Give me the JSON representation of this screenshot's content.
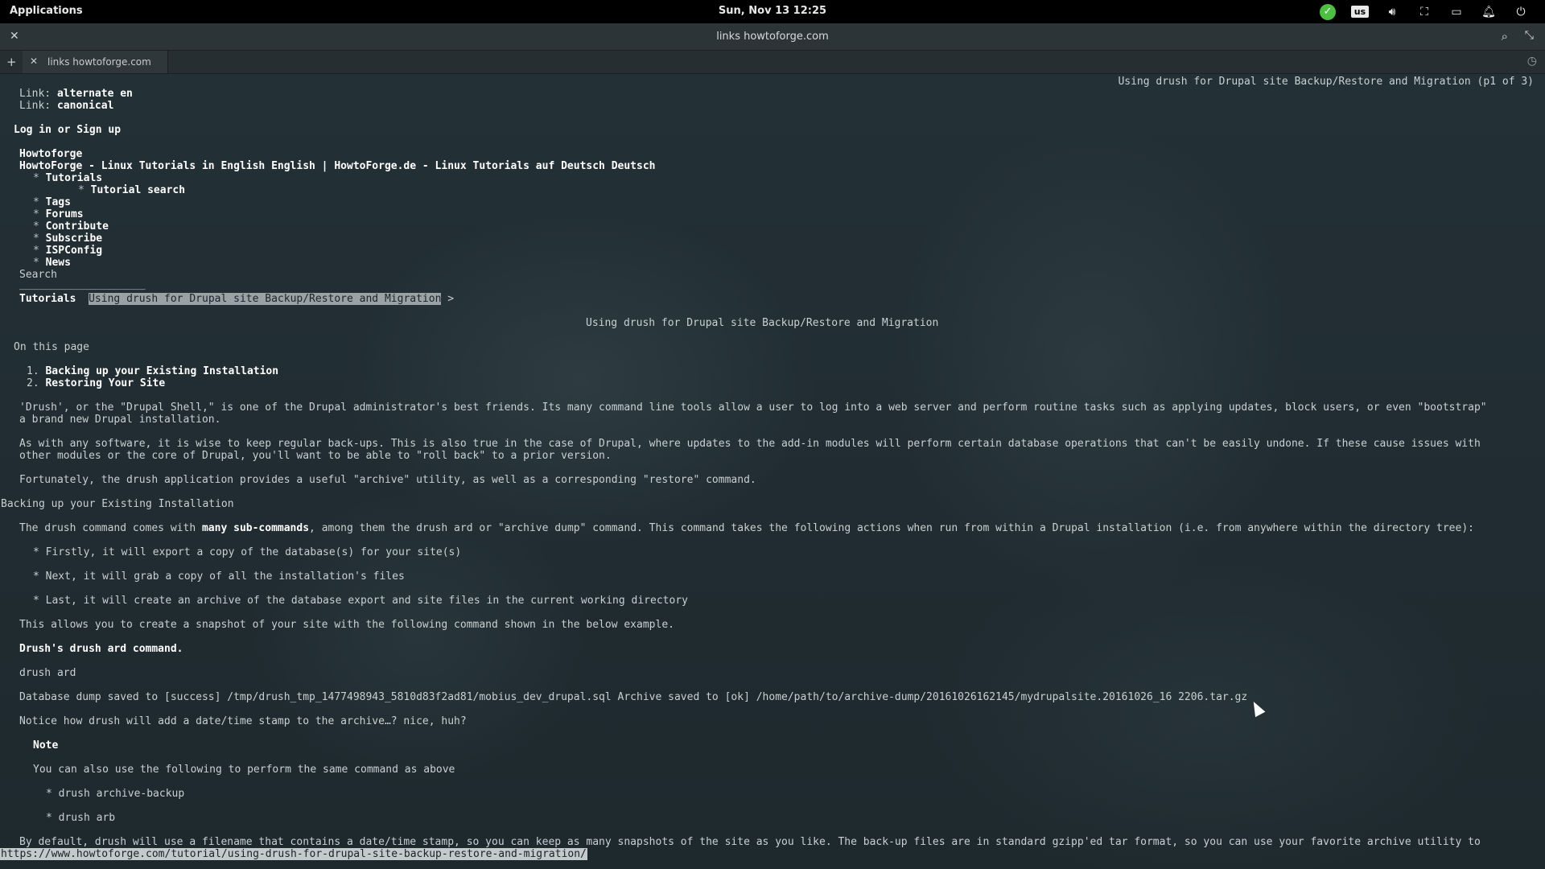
{
  "panel": {
    "apps_label": "Applications",
    "datetime": "Sun, Nov 13   12:25",
    "keyboard_layout": "us",
    "colors": {
      "status_ok": "#4fbf43"
    }
  },
  "window": {
    "title": "links howtoforge.com",
    "tab_label": "links howtoforge.com"
  },
  "page": {
    "position": "Using drush for Drupal site Backup/Restore and Migration (p1 of 3)",
    "link1_prefix": "Link: ",
    "link1": "alternate en",
    "link2_prefix": "Link: ",
    "link2": "canonical",
    "login": "Log in or Sign up",
    "site": "Howtoforge",
    "lang_line": "HowtoForge - Linux Tutorials in English English | HowtoForge.de - Linux Tutorials auf Deutsch Deutsch",
    "nav": {
      "tutorials": "Tutorials",
      "tutorial_search": "Tutorial search",
      "tags": "Tags",
      "forums": "Forums",
      "contribute": "Contribute",
      "subscribe": "Subscribe",
      "ispconfig": "ISPConfig",
      "news": "News"
    },
    "search_label": "Search",
    "search_field": "____________________",
    "breadcrumb_root": "Tutorials",
    "breadcrumb_current": "Using drush for Drupal site Backup/Restore and Migration",
    "breadcrumb_sep": ">",
    "heading": "Using drush for Drupal site Backup/Restore and Migration",
    "toc_label": "On this page",
    "toc1_num": "1.",
    "toc1": "Backing up your Existing Installation",
    "toc2_num": "2.",
    "toc2": "Restoring Your Site",
    "p1a": "'Drush', or the \"Drupal Shell,\" is one of the Drupal administrator's best friends. Its many command line tools allow a user to log into a web server and perform routine tasks such as applying updates, block users, or even \"bootstrap\"",
    "p1b": "a brand new Drupal installation.",
    "p2a": "As with any software, it is wise to keep regular back-ups. This is also true in the case of Drupal, where updates to the add-in modules will perform certain database operations that can't be easily undone. If these cause issues with",
    "p2b": "other modules or the core of Drupal, you'll want to be able to \"roll back\" to a prior version.",
    "p3": "Fortunately, the drush application provides a useful \"archive\" utility, as well as a corresponding \"restore\" command.",
    "section1": "Backing up your Existing Installation",
    "p4_pre": "The drush command comes with ",
    "p4_link": "many sub-commands",
    "p4_post": ", among them the drush ard or \"archive dump\" command. This command takes the following actions when run from within a Drupal installation (i.e. from anywhere within the directory tree):",
    "bullet1": "* Firstly, it will export a copy of the database(s) for your site(s)",
    "bullet2": "* Next, it will grab a copy of all the installation's files",
    "bullet3": "* Last, it will create an archive of the database export and site files in the current working directory",
    "p5": "This allows you to create a snapshot of your site with the following command shown in the below example.",
    "caption": "Drush's drush ard command.",
    "cmd": "drush ard",
    "output": "Database dump saved to [success] /tmp/drush_tmp_1477498943_5810d83f2ad81/mobius_dev_drupal.sql Archive saved to [ok] /home/path/to/archive-dump/20161026162145/mydrupalsite.20161026_16 2206.tar.gz",
    "p6": "Notice how drush will add a date/time stamp to the archive…? nice, huh?",
    "note_title": "Note",
    "note_text": "You can also use the following to perform the same command as above",
    "alt1": "* drush archive-backup",
    "alt2": "* drush arb",
    "p7": "By default, drush will use a filename that contains a date/time stamp, so you can keep as many snapshots of the site as you like. The back-up files are in standard gzipp'ed tar format, so you can use your favorite archive utility to",
    "status_url": "https://www.howtoforge.com/tutorial/using-drush-for-drupal-site-backup-restore-and-migration/"
  }
}
